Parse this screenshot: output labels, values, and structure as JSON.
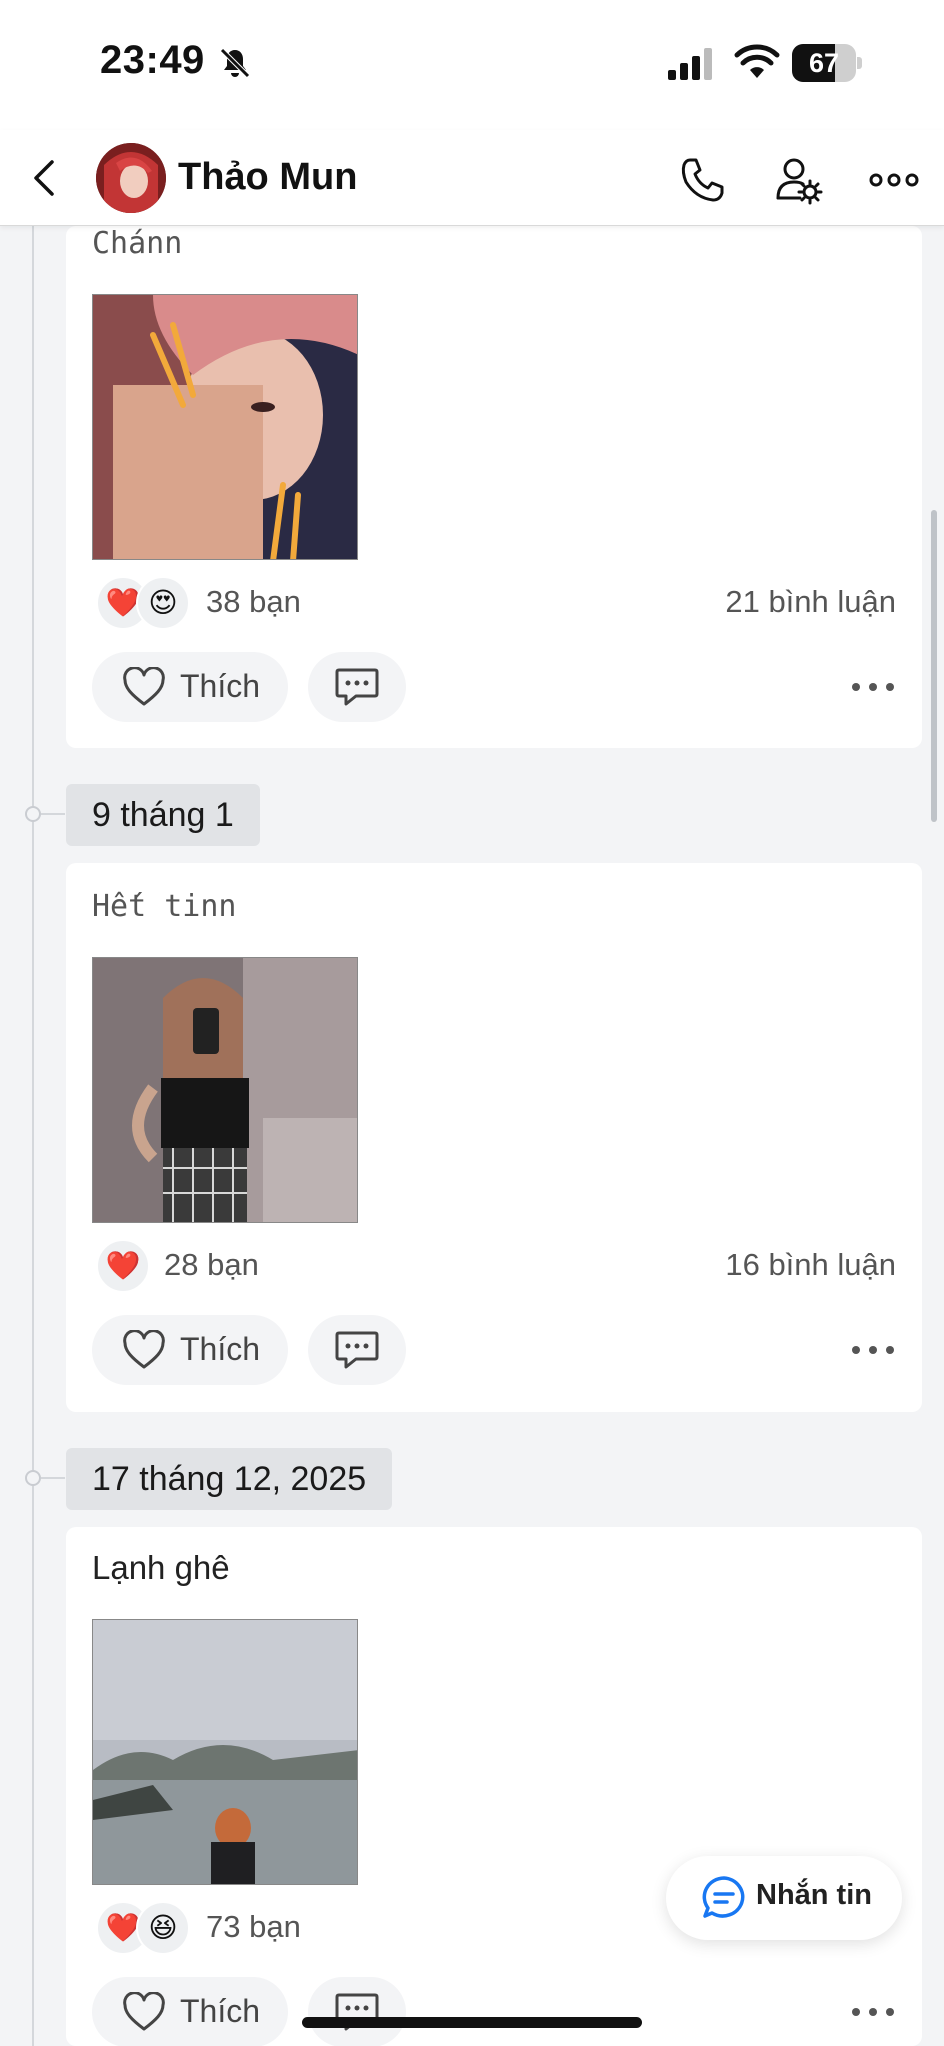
{
  "status_bar": {
    "time": "23:49",
    "battery": "67",
    "battery_level": 0.67
  },
  "header": {
    "name": "Thảo Mun"
  },
  "colors": {
    "background": "#f3f4f6",
    "card": "#ffffff",
    "heart": "#e3223a",
    "accent": "#1877f2"
  },
  "icons": {
    "status": [
      "bell-slash-icon",
      "signal-icon",
      "wifi-icon",
      "battery-icon"
    ],
    "header": [
      "back-arrow-icon",
      "phone-icon",
      "user-settings-icon",
      "more-horizontal-icon"
    ],
    "post": [
      "heart-icon",
      "comment-icon",
      "more-horizontal-icon"
    ],
    "float": [
      "chat-bubble-icon"
    ]
  },
  "posts": [
    {
      "caption": "Chánn",
      "reactions": [
        "❤️",
        "😍"
      ],
      "reaction_count": "38 bạn",
      "comments": "21 bình luận",
      "like_label": "Thích"
    },
    {
      "date": "9 tháng 1",
      "caption": "Hết tinn",
      "reactions": [
        "❤️"
      ],
      "reaction_count": "28 bạn",
      "comments": "16 bình luận",
      "like_label": "Thích"
    },
    {
      "date": "17 tháng 12, 2025",
      "caption": "Lạnh ghê",
      "reactions": [
        "❤️",
        "😆"
      ],
      "reaction_count": "73 bạn",
      "comments": "",
      "like_label": "Thích"
    }
  ],
  "message_button": {
    "label": "Nhắn tin"
  }
}
